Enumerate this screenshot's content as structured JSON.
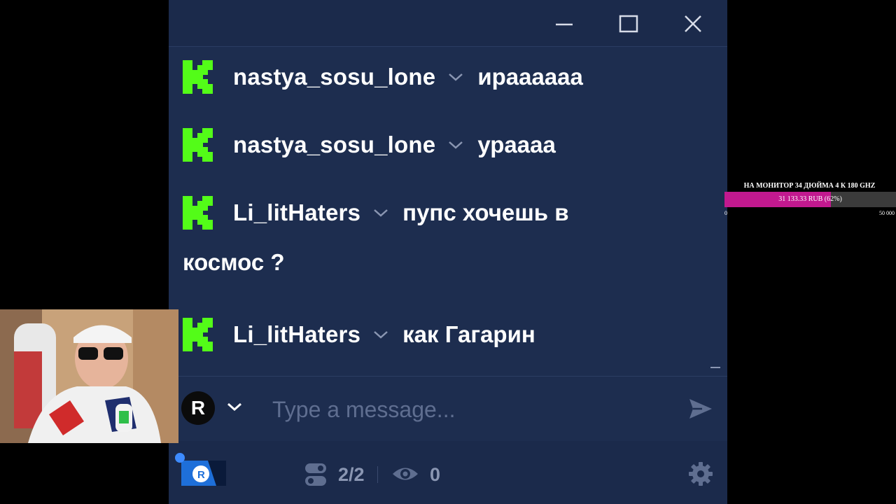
{
  "window": {
    "controls": {
      "minimize_icon": "minimize-icon",
      "maximize_icon": "maximize-icon",
      "close_icon": "close-icon"
    }
  },
  "messages": [
    {
      "badge_icon": "kick-logo-icon",
      "username": "nastya_sosu_lone",
      "text": "ираааааа"
    },
    {
      "badge_icon": "kick-logo-icon",
      "username": "nastya_sosu_lone",
      "text": "ураааа"
    },
    {
      "badge_icon": "kick-logo-icon",
      "username": "Li_litHaters",
      "text": "пупс хочешь в",
      "text_continued": "космос ?"
    },
    {
      "badge_icon": "kick-logo-icon",
      "username": "Li_litHaters",
      "text": "как Гагарин"
    }
  ],
  "composer": {
    "avatar_letter": "R",
    "placeholder": "Type a message...",
    "value": "",
    "send_icon": "send-icon"
  },
  "status": {
    "connections": "2/2",
    "viewers": "0",
    "settings_icon": "gear-icon"
  },
  "donation_goal": {
    "title": "НА МОНИТОР 34 ДЮЙМА 4 К 180 GHZ",
    "amount_text": "31 133.33 RUB (62%)",
    "progress_fraction": 0.62,
    "min_label": "0",
    "max_label": "50 000",
    "fill_color": "#c2198f"
  },
  "colors": {
    "chat_bg": "#1d2d4f",
    "kick_green": "#53fc18",
    "muted_text": "#8a96b2"
  }
}
